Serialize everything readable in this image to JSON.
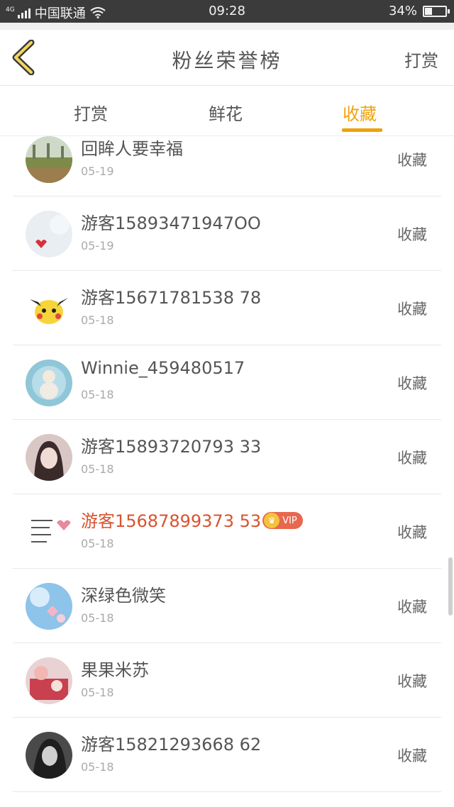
{
  "status_bar": {
    "network": "4G",
    "carrier": "中国联通",
    "time": "09:28",
    "battery": "34%",
    "battery_level": 0.34
  },
  "nav": {
    "title": "粉丝荣誉榜",
    "action": "打赏",
    "back_icon": "chevron-left-icon"
  },
  "tabs": [
    {
      "label": "打赏",
      "active": false
    },
    {
      "label": "鲜花",
      "active": false
    },
    {
      "label": "收藏",
      "active": true
    }
  ],
  "accent_color": "#f0a20a",
  "vip_color": "#d9532f",
  "list": [
    {
      "name": "回眸人要幸福",
      "date": "05-19",
      "action": "收藏",
      "vip": false
    },
    {
      "name": "游客15893471947OO",
      "date": "05-19",
      "action": "收藏",
      "vip": false
    },
    {
      "name": "游客15671781538 78",
      "date": "05-18",
      "action": "收藏",
      "vip": false
    },
    {
      "name": "Winnie_459480517",
      "date": "05-18",
      "action": "收藏",
      "vip": false
    },
    {
      "name": "游客15893720793 33",
      "date": "05-18",
      "action": "收藏",
      "vip": false
    },
    {
      "name": "游客15687899373 53",
      "date": "05-18",
      "action": "收藏",
      "vip": true,
      "vip_label": "VIP"
    },
    {
      "name": "深绿色微笑",
      "date": "05-18",
      "action": "收藏",
      "vip": false
    },
    {
      "name": "果果米苏",
      "date": "05-18",
      "action": "收藏",
      "vip": false
    },
    {
      "name": "游客15821293668 62",
      "date": "05-18",
      "action": "收藏",
      "vip": false
    }
  ]
}
